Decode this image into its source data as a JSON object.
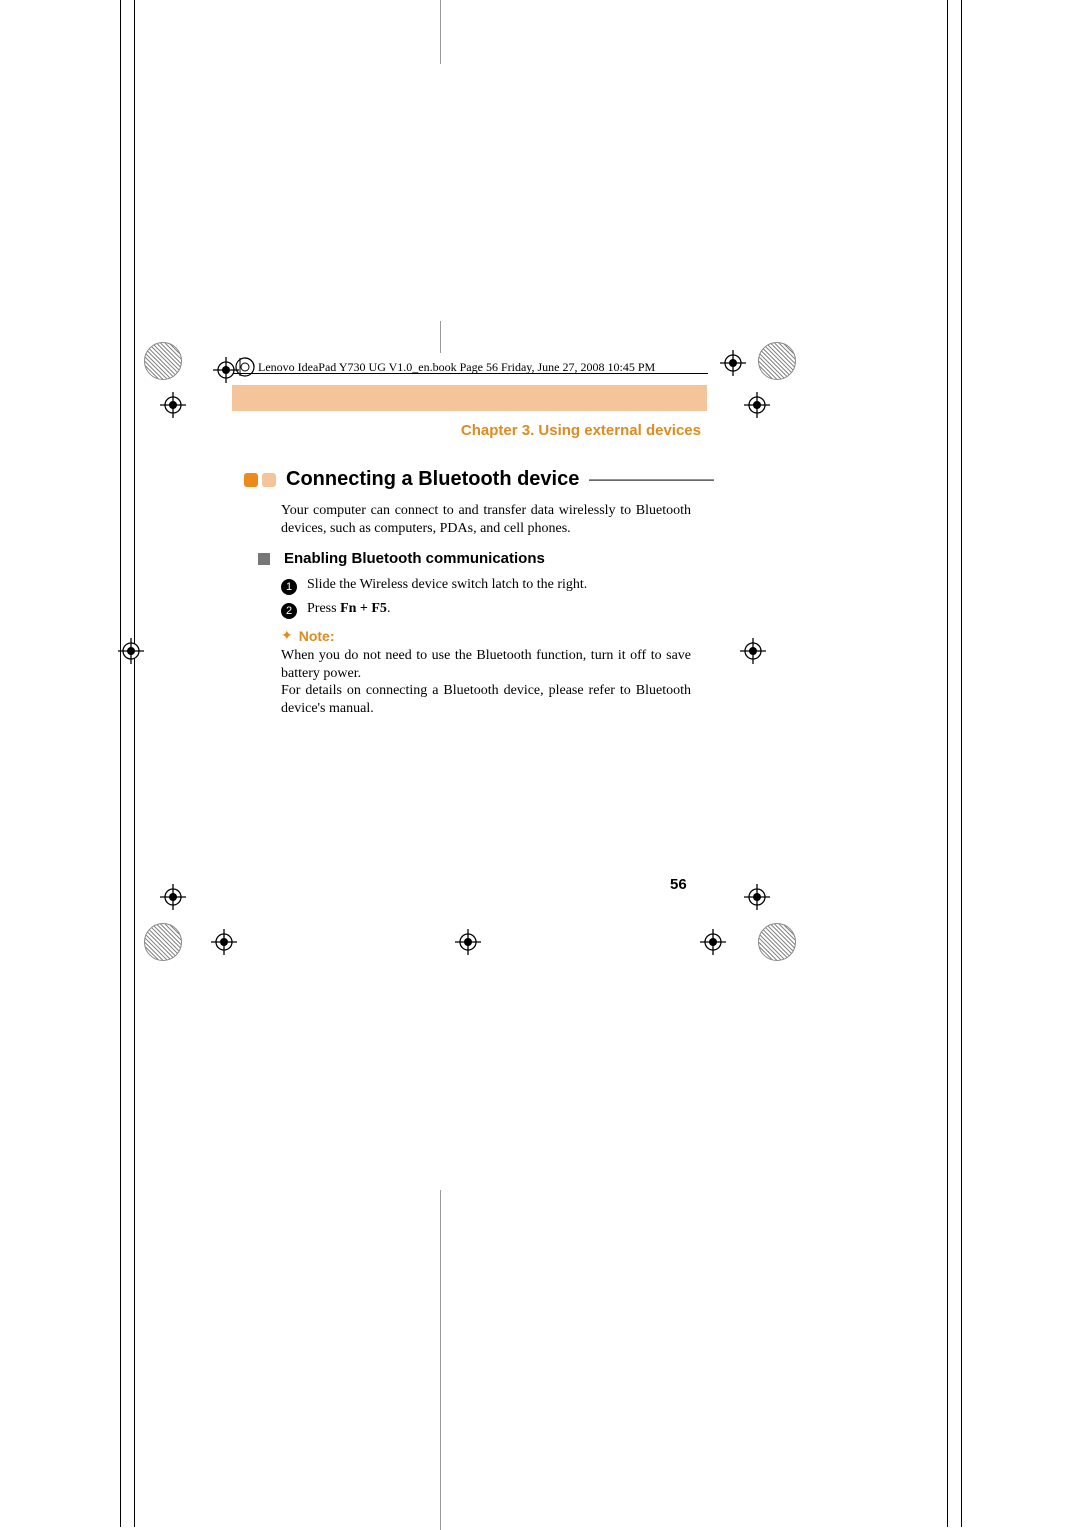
{
  "book_header": "Lenovo IdeaPad Y730 UG V1.0_en.book  Page 56  Friday, June 27, 2008  10:45 PM",
  "chapter": "Chapter 3. Using external devices",
  "section_title": "Connecting a Bluetooth device",
  "intro": "Your computer can connect to and transfer data wirelessly to Bluetooth devices, such as computers, PDAs, and cell phones.",
  "sub_title": "Enabling Bluetooth communications",
  "steps": {
    "s1": "Slide the Wireless device switch latch to the right.",
    "s2_pre": "Press ",
    "s2_bold": "Fn + F5",
    "s2_post": "."
  },
  "note_label": "Note:",
  "note_body_1": "When you do not need to use the Bluetooth function, turn it off to save battery power.",
  "note_body_2": "For details on connecting a Bluetooth device, please refer to Bluetooth device's manual.",
  "page_number": "56",
  "colors": {
    "accent": "#e08a1f",
    "band": "#f4c59a"
  }
}
